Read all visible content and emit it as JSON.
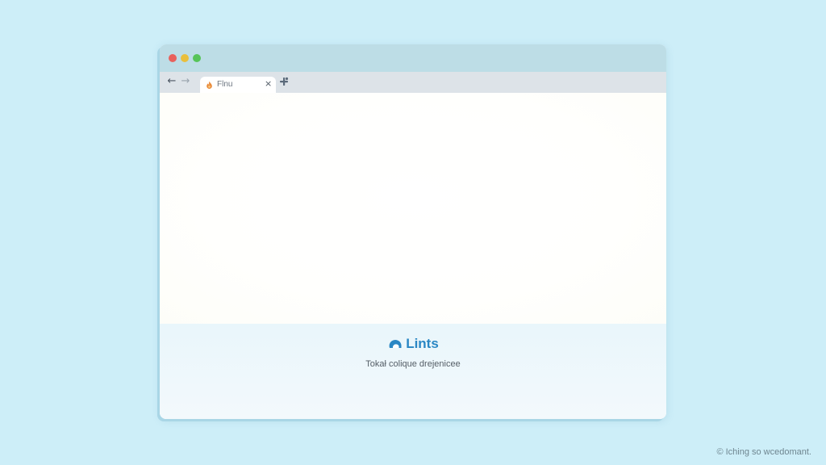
{
  "browser": {
    "tab": {
      "label": "Flnu",
      "favicon": "flame-icon",
      "close_label": "×"
    },
    "nav": {
      "back_label": "←",
      "forward_label": "→"
    },
    "new_tab_icon": "plus-icon"
  },
  "page": {
    "brand": {
      "name": "Lints",
      "logo": "cloud-icon"
    },
    "tagline": "Tokał colique drejenicee"
  },
  "watermark": "© Iching so wcedomant.",
  "colors": {
    "background": "#cdeef8",
    "titlebar": "#bddde6",
    "tabbar": "#dde3e8",
    "brand": "#2a87c4",
    "traffic_red": "#e8615c",
    "traffic_yellow": "#e9bf3c",
    "traffic_green": "#56c458"
  }
}
